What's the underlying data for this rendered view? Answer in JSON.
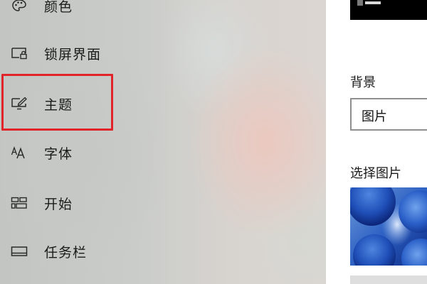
{
  "sidebar": {
    "items": [
      {
        "label": "颜色",
        "icon": "palette-icon"
      },
      {
        "label": "锁屏界面",
        "icon": "lock-screen-icon"
      },
      {
        "label": "主题",
        "icon": "theme-brush-icon",
        "highlighted": true
      },
      {
        "label": "字体",
        "icon": "font-icon"
      },
      {
        "label": "开始",
        "icon": "start-layout-icon"
      },
      {
        "label": "任务栏",
        "icon": "taskbar-icon"
      }
    ]
  },
  "highlight_color": "#e0242a",
  "content": {
    "background_label": "背景",
    "background_select_value": "图片",
    "choose_picture_label": "选择图片"
  }
}
